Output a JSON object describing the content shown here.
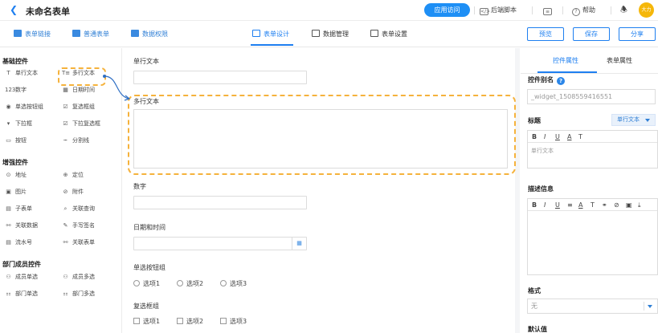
{
  "topbar": {
    "title": "未命名表单",
    "app_visit": "应用访问",
    "backend_script": "后端脚本",
    "help": "帮助",
    "avatar_text": "大力"
  },
  "toolbar": {
    "nav": [
      "表单链接",
      "普通表单",
      "数据权限"
    ],
    "tabs": [
      "表单设计",
      "数据管理",
      "表单设置"
    ],
    "preview": "预览",
    "save": "保存",
    "share": "分享"
  },
  "left_panel": {
    "basic_title": "基础控件",
    "basic": [
      {
        "label": "单行文本",
        "icon": "T"
      },
      {
        "label": "多行文本",
        "icon": "T≡"
      },
      {
        "label": "数字",
        "icon": "123"
      },
      {
        "label": "日期时间",
        "icon": "▦"
      },
      {
        "label": "单选按钮组",
        "icon": "◉"
      },
      {
        "label": "复选框组",
        "icon": "☑"
      },
      {
        "label": "下拉框",
        "icon": "▾"
      },
      {
        "label": "下拉复选框",
        "icon": "☑"
      },
      {
        "label": "按钮",
        "icon": "▭"
      },
      {
        "label": "分割线",
        "icon": "┅"
      }
    ],
    "enhanced_title": "增强控件",
    "enhanced": [
      {
        "label": "地址",
        "icon": "⊙"
      },
      {
        "label": "定位",
        "icon": "⊕"
      },
      {
        "label": "图片",
        "icon": "▣"
      },
      {
        "label": "附件",
        "icon": "⊘"
      },
      {
        "label": "子表单",
        "icon": "▤"
      },
      {
        "label": "关联查询",
        "icon": "⌕"
      },
      {
        "label": "关联数据",
        "icon": "⚯"
      },
      {
        "label": "手写签名",
        "icon": "✎"
      },
      {
        "label": "流水号",
        "icon": "▤"
      },
      {
        "label": "关联表单",
        "icon": "⚯"
      }
    ],
    "dept_title": "部门成员控件",
    "dept": [
      {
        "label": "成员单选",
        "icon": "⚇"
      },
      {
        "label": "成员多选",
        "icon": "⚇"
      },
      {
        "label": "部门单选",
        "icon": "⚏"
      },
      {
        "label": "部门多选",
        "icon": "⚏"
      }
    ]
  },
  "form": {
    "single_text_label": "单行文本",
    "multi_text_label": "多行文本",
    "number_label": "数字",
    "datetime_label": "日期和时间",
    "radio_label": "单选按钮组",
    "radio_options": [
      "选项1",
      "选项2",
      "选项3"
    ],
    "checkbox_label": "复选框组",
    "checkbox_options": [
      "选项1",
      "选项2",
      "选项3"
    ]
  },
  "right_panel": {
    "tabs": [
      "控件属性",
      "表单属性"
    ],
    "alias_label": "控件别名",
    "alias_value": "_widget_1508559416551",
    "title_label": "标题",
    "title_type": "单行文本",
    "title_value": "单行文本",
    "desc_label": "描述信息",
    "format_label": "格式",
    "format_value": "无",
    "default_label": "默认值"
  },
  "colors": {
    "primary": "#1e8ff5",
    "highlight_dash": "#f5b23c",
    "avatar": "#f5b70a"
  }
}
